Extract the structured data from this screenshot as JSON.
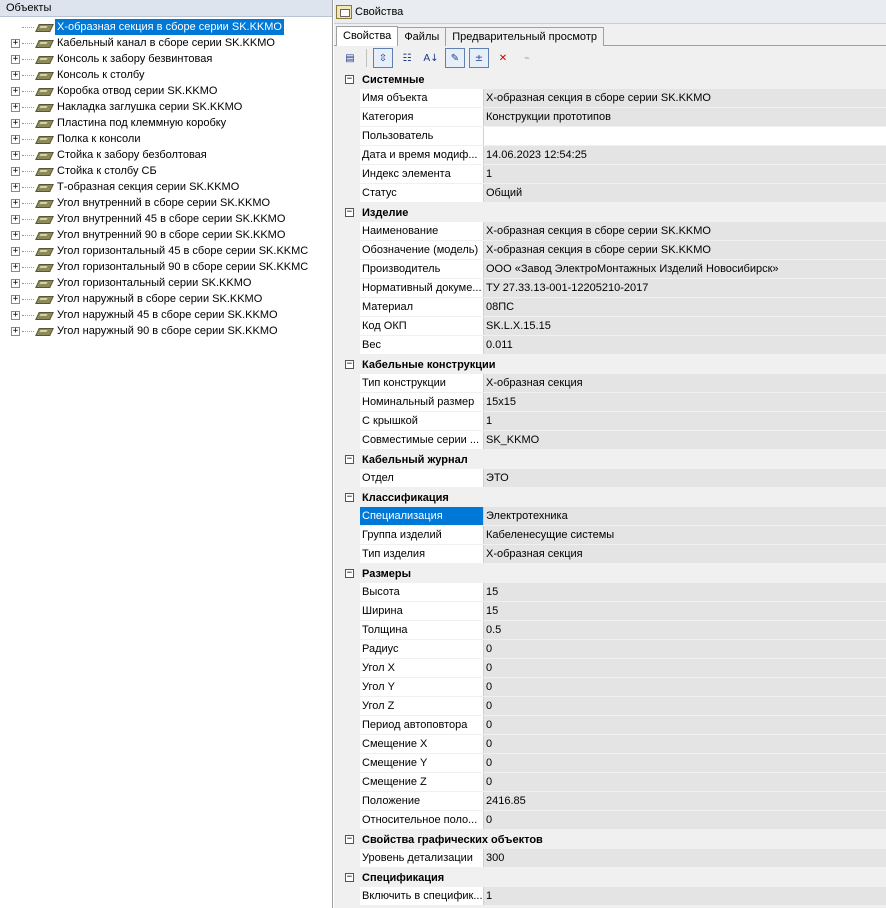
{
  "left_panel": {
    "title": "Объекты",
    "items": [
      {
        "label": "Х-образная секция в сборе серии SK.KKMO",
        "selected": true,
        "expandable": false
      },
      {
        "label": "Кабельный канал в сборе серии SK.KKMO",
        "expandable": true
      },
      {
        "label": "Консоль к забору безвинтовая",
        "expandable": true
      },
      {
        "label": "Консоль к столбу",
        "expandable": true
      },
      {
        "label": "Коробка отвод серии SK.KKMO",
        "expandable": true
      },
      {
        "label": "Накладка заглушка серии SK.KKMO",
        "expandable": true
      },
      {
        "label": "Пластина под клеммную коробку",
        "expandable": true
      },
      {
        "label": "Полка к консоли",
        "expandable": true
      },
      {
        "label": "Стойка к забору безболтовая",
        "expandable": true
      },
      {
        "label": "Стойка к столбу СБ",
        "expandable": true
      },
      {
        "label": "Т-образная секция серии SK.KKMO",
        "expandable": true
      },
      {
        "label": "Угол внутренний в сборе серии SK.KKMO",
        "expandable": true
      },
      {
        "label": "Угол внутренний 45 в сборе серии SK.KKMO",
        "expandable": true
      },
      {
        "label": "Угол внутренний 90 в сборе серии SK.KKMO",
        "expandable": true
      },
      {
        "label": "Угол горизонтальный 45 в сборе серии SK.KKMC",
        "expandable": true
      },
      {
        "label": "Угол горизонтальный 90 в сборе серии SK.KKMC",
        "expandable": true
      },
      {
        "label": "Угол горизонтальный серии SK.KKMO",
        "expandable": true
      },
      {
        "label": "Угол наружный в сборе серии SK.KKMO",
        "expandable": true
      },
      {
        "label": "Угол наружный 45 в сборе серии SK.KKMO",
        "expandable": true
      },
      {
        "label": "Угол наружный 90 в сборе серии SK.KKMO",
        "expandable": true
      }
    ]
  },
  "right_panel": {
    "title": "Свойства",
    "tabs": [
      "Свойства",
      "Файлы",
      "Предварительный просмотр"
    ],
    "active_tab": 0,
    "toolbar_icons": [
      "properties-page-icon",
      "sort-categorized-icon",
      "sort-alphabetical-icon",
      "edit-icon",
      "add-remove-icon",
      "delete-icon",
      "link-icon"
    ],
    "categories": [
      {
        "name": "Системные",
        "props": [
          {
            "name": "Имя объекта",
            "value": "Х-образная секция в сборе серии SK.KKMO"
          },
          {
            "name": "Категория",
            "value": "Конструкции прототипов"
          },
          {
            "name": "Пользователь",
            "value": "",
            "white": true
          },
          {
            "name": "Дата и время модиф...",
            "value": "14.06.2023 12:54:25"
          },
          {
            "name": "Индекс элемента",
            "value": "1"
          },
          {
            "name": "Статус",
            "value": "Общий"
          }
        ]
      },
      {
        "name": "Изделие",
        "props": [
          {
            "name": "Наименование",
            "value": "Х-образная секция в сборе серии SK.KKMO"
          },
          {
            "name": "Обозначение (модель)",
            "value": "Х-образная секция в сборе серии SK.KKMO"
          },
          {
            "name": "Производитель",
            "value": "ООО «Завод ЭлектроМонтажных Изделий Новосибирск»"
          },
          {
            "name": "Нормативный докуме...",
            "value": "ТУ 27.33.13-001-12205210-2017"
          },
          {
            "name": "Материал",
            "value": "08ПС"
          },
          {
            "name": "Код ОКП",
            "value": "SK.L.X.15.15"
          },
          {
            "name": "Вес",
            "value": "0.011"
          }
        ]
      },
      {
        "name": "Кабельные конструкции",
        "props": [
          {
            "name": "Тип конструкции",
            "value": "Х-образная секция"
          },
          {
            "name": "Номинальный размер",
            "value": "15x15"
          },
          {
            "name": "С крышкой",
            "value": "1"
          },
          {
            "name": "Совместимые серии ...",
            "value": "SK_KKMO"
          }
        ]
      },
      {
        "name": "Кабельный журнал",
        "props": [
          {
            "name": "Отдел",
            "value": "ЭТО"
          }
        ]
      },
      {
        "name": "Классификация",
        "props": [
          {
            "name": "Специализация",
            "value": "Электротехника",
            "selected": true
          },
          {
            "name": "Группа изделий",
            "value": "Кабеленесущие системы"
          },
          {
            "name": "Тип изделия",
            "value": "Х-образная секция"
          }
        ]
      },
      {
        "name": "Размеры",
        "props": [
          {
            "name": "Высота",
            "value": "15"
          },
          {
            "name": "Ширина",
            "value": "15"
          },
          {
            "name": "Толщина",
            "value": "0.5"
          },
          {
            "name": "Радиус",
            "value": "0"
          },
          {
            "name": "Угол X",
            "value": "0"
          },
          {
            "name": "Угол Y",
            "value": "0"
          },
          {
            "name": "Угол Z",
            "value": "0"
          },
          {
            "name": "Период автоповтора",
            "value": "0"
          },
          {
            "name": "Смещение X",
            "value": "0"
          },
          {
            "name": "Смещение Y",
            "value": "0"
          },
          {
            "name": "Смещение Z",
            "value": "0"
          },
          {
            "name": "Положение",
            "value": "2416.85"
          },
          {
            "name": "Относительное поло...",
            "value": "0"
          }
        ]
      },
      {
        "name": "Свойства графических объектов",
        "props": [
          {
            "name": "Уровень детализации",
            "value": "300"
          }
        ]
      },
      {
        "name": "Спецификация",
        "props": [
          {
            "name": "Включить в специфик...",
            "value": "1"
          }
        ]
      }
    ]
  }
}
